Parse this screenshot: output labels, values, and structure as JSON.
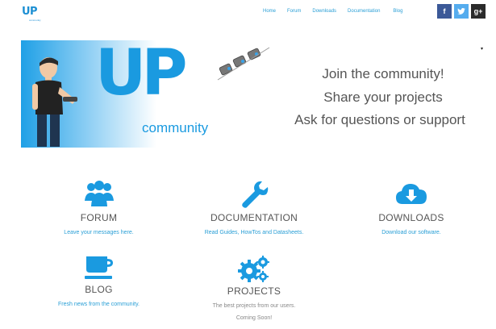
{
  "header": {
    "logo_mark": "UP",
    "logo_sub": "community",
    "nav": {
      "home": "Home",
      "forum": "Forum",
      "downloads": "Downloads",
      "documentation": "Documentation",
      "blog": "Blog"
    },
    "social": {
      "facebook": "f",
      "twitter": "t",
      "googleplus": "g+"
    },
    "colors": {
      "accent": "#2a9fd6",
      "facebook": "#3b5998",
      "twitter": "#55acee",
      "googleplus": "#2b2b2b"
    }
  },
  "banner": {
    "logo_text": "UP",
    "community_text": "community",
    "taglines": [
      "Join the community!",
      "Share your projects",
      "Ask for questions or support"
    ]
  },
  "features": [
    {
      "icon": "users-icon",
      "title": "FORUM",
      "desc": "Leave your messages here."
    },
    {
      "icon": "wrench-icon",
      "title": "DOCUMENTATION",
      "desc": "Read Guides, HowTos and Datasheets."
    },
    {
      "icon": "cloud-download-icon",
      "title": "DOWNLOADS",
      "desc": "Download our software."
    },
    {
      "icon": "coffee-cup-icon",
      "title": "BLOG",
      "desc": "Fresh news from the community."
    },
    {
      "icon": "gears-icon",
      "title": "PROJECTS",
      "desc": "The best projects from our users.",
      "desc_extra": "Coming Soon!"
    }
  ]
}
